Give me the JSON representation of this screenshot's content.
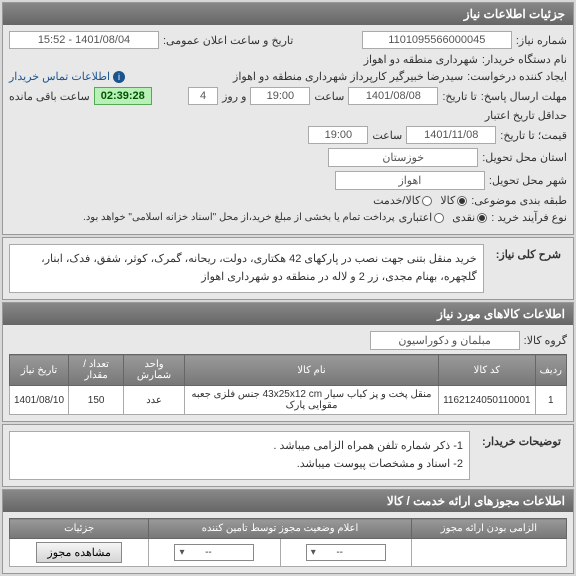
{
  "panel1": {
    "title": "جزئیات اطلاعات نیاز",
    "need_no_lbl": "شماره نیاز:",
    "need_no": "1101095566000045",
    "pub_date_lbl": "تاریخ و ساعت اعلان عمومی:",
    "pub_date": "1401/08/04 - 15:52",
    "buyer_lbl": "نام دستگاه خریدار:",
    "buyer": "شهرداری منطقه دو اهواز",
    "creator_lbl": "ایجاد کننده درخواست:",
    "creator": "سیدرضا خبیرگیر کارپرداز  شهرداری منطقه دو اهواز",
    "contact": "اطلاعات تماس خریدار",
    "deadline_lbl": "مهلت ارسال پاسخ:",
    "deadline_sub": "تا تاریخ:",
    "deadline_date": "1401/08/08",
    "time_lbl": "ساعت",
    "deadline_time": "19:00",
    "day_lbl": "و روز",
    "days": "4",
    "timer": "02:39:28",
    "remain_lbl": "ساعت باقی مانده",
    "validity_lbl": "حداقل تاریخ اعتبار",
    "validity_sub": "قیمت؛ تا تاریخ:",
    "validity_date": "1401/11/08",
    "validity_time": "19:00",
    "province_lbl": "استان محل تحویل:",
    "province": "خوزستان",
    "city_lbl": "شهر محل تحویل:",
    "city": "اهواز",
    "category_lbl": "طبقه بندی موضوعی:",
    "cat_goods": "کالا",
    "cat_service": "کالا/خدمت",
    "process_lbl": "نوع فرآیند خرید :",
    "proc_cash": "نقدی",
    "proc_credit": "اعتباری",
    "process_note": "پرداخت تمام یا بخشی از مبلغ خرید،از محل \"اسناد خزانه اسلامی\" خواهد بود."
  },
  "desc": {
    "label": "شرح کلی نیاز:",
    "text": "خرید منقل بتنی جهت نصب در پارکهای 42 هکتاری، دولت، ریحانه، گمرک، کوثر، شفق، فدک، ابنار، گلچهره، بهنام مجدی، زر 2 و لاله در منطقه دو شهرداری اهواز"
  },
  "items": {
    "title": "اطلاعات کالاهای مورد نیاز",
    "group_lbl": "گروه کالا:",
    "group": "مبلمان و دکوراسیون",
    "headers": [
      "ردیف",
      "کد کالا",
      "نام کالا",
      "واحد شمارش",
      "تعداد / مقدار",
      "تاریخ نیاز"
    ],
    "rows": [
      [
        "1",
        "1162124050110001",
        "منقل پخت و پز کباب سیار 43x25x12 cm جنس فلزی جعبه مقوایی پارک",
        "عدد",
        "150",
        "1401/08/10"
      ]
    ]
  },
  "buyer_notes": {
    "label": "توضیحات خریدار:",
    "line1": "1- ذکر شماره تلفن همراه الزامی میباشد .",
    "line2": "2- اسناد و مشخصات پیوست میباشد."
  },
  "permits": {
    "title": "اطلاعات مجوزهای ارائه خدمت / کالا",
    "mandatory_lbl": "الزامی بودن ارائه مجوز",
    "status_title": "اعلام وضعیت مجوز توسط تامین کننده",
    "select_placeholder": "--",
    "details_lbl": "جزئیات",
    "view_btn": "مشاهده مجوز"
  }
}
